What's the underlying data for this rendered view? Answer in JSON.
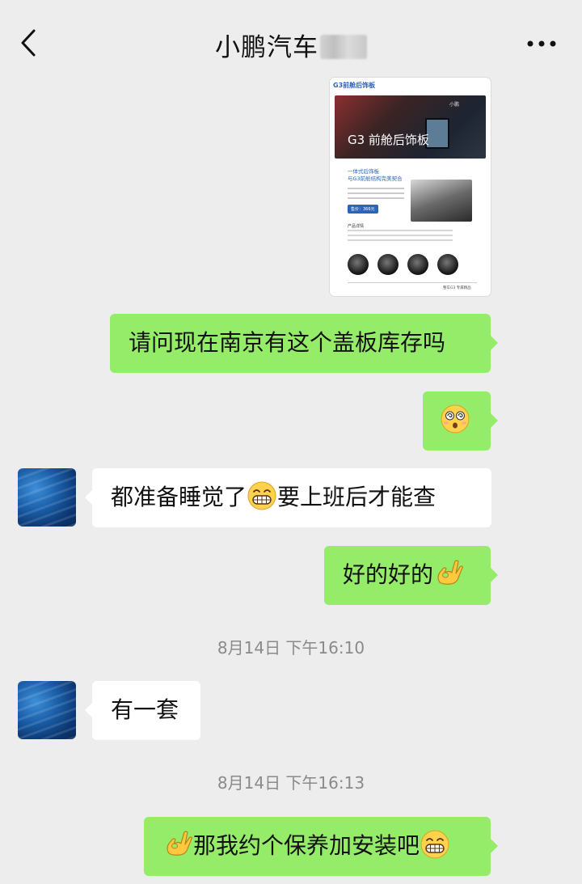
{
  "header": {
    "title": "小鹏汽车",
    "back_icon": "chevron-left-icon",
    "more_icon": "ellipsis-icon"
  },
  "image_card": {
    "doc_title": "G3前舱后饰板",
    "hero_text": "G3 前舱后饰板",
    "brand": "小鹏",
    "subtitle_line1": "一体式后饰板",
    "subtitle_line2": "与G3前舱结构完美契合",
    "price": "售价：366元",
    "spec_title": "产品详情",
    "footer": "整车G3 专属精品"
  },
  "messages": [
    {
      "side": "right",
      "text": "请问现在南京有这个盖板库存吗"
    },
    {
      "side": "right",
      "emoji": "dizzy-surprised-face-emoji"
    },
    {
      "side": "left",
      "text_before": "都准备睡觉了",
      "emoji": "grinning-teeth-emoji",
      "text_after": "要上班后才能查"
    },
    {
      "side": "right",
      "text": "好的好的",
      "emoji": "ok-hand-emoji"
    },
    {
      "side": "left",
      "text": "有一套"
    },
    {
      "side": "right",
      "emoji_before": "ok-hand-emoji",
      "text": "那我约个保养加安装吧",
      "emoji_after": "grinning-teeth-emoji"
    }
  ],
  "timestamps": [
    "8月14日 下午16:10",
    "8月14日 下午16:13"
  ],
  "colors": {
    "background": "#ededed",
    "sent_bubble": "#95ec69",
    "received_bubble": "#ffffff",
    "timestamp": "#8a8a8a"
  }
}
